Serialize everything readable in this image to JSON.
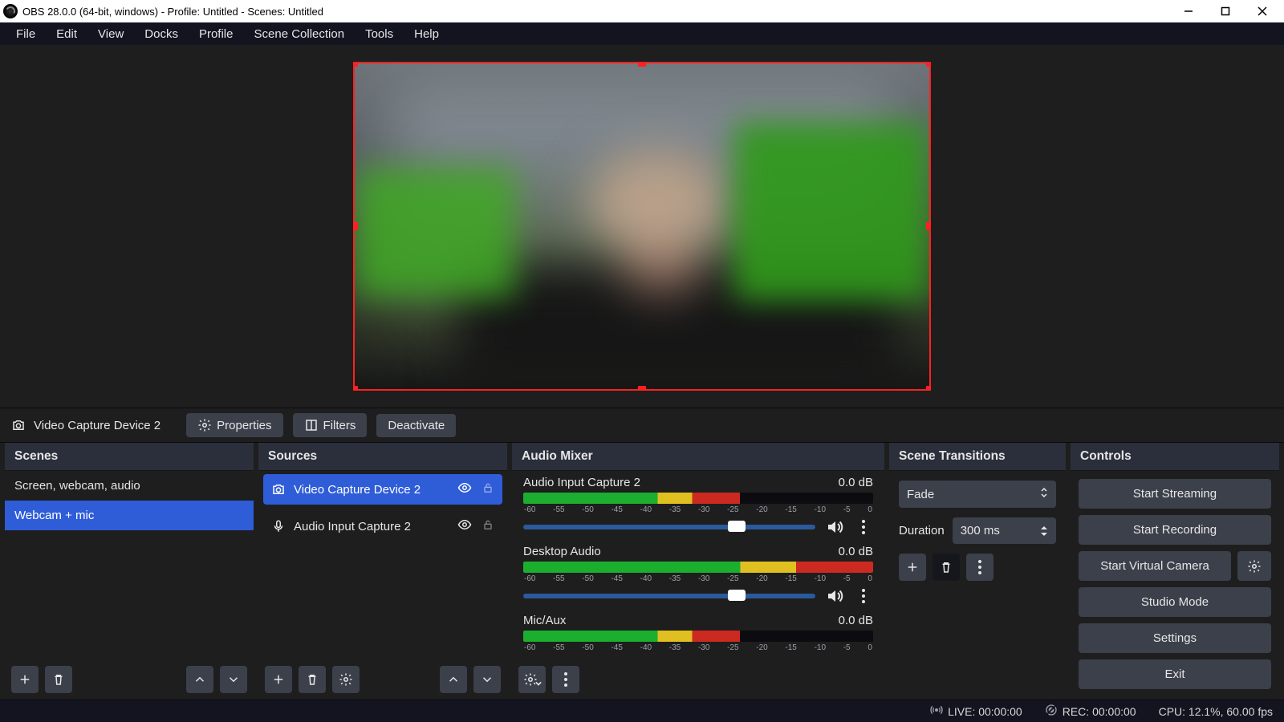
{
  "titlebar": {
    "text": "OBS 28.0.0 (64-bit, windows) - Profile: Untitled - Scenes: Untitled"
  },
  "menu": {
    "items": [
      "File",
      "Edit",
      "View",
      "Docks",
      "Profile",
      "Scene Collection",
      "Tools",
      "Help"
    ]
  },
  "contextbar": {
    "source_label": "Video Capture Device 2",
    "properties": "Properties",
    "filters": "Filters",
    "deactivate": "Deactivate"
  },
  "docks": {
    "scenes": {
      "title": "Scenes",
      "items": [
        "Screen, webcam, audio",
        "Webcam + mic"
      ],
      "selected_index": 1
    },
    "sources": {
      "title": "Sources",
      "items": [
        {
          "name": "Video Capture Device 2",
          "icon": "camera",
          "visible": true,
          "locked": false,
          "selected": true
        },
        {
          "name": "Audio Input Capture 2",
          "icon": "mic",
          "visible": true,
          "locked": false,
          "selected": false
        }
      ]
    },
    "mixer": {
      "title": "Audio Mixer",
      "ticks": [
        "-60",
        "-55",
        "-50",
        "-45",
        "-40",
        "-35",
        "-30",
        "-25",
        "-20",
        "-15",
        "-10",
        "-5",
        "0"
      ],
      "channels": [
        {
          "name": "Audio Input Capture 2",
          "db": "0.0 dB",
          "level_pct": 62,
          "slider_pct": 73
        },
        {
          "name": "Desktop Audio",
          "db": "0.0 dB",
          "level_pct": 100,
          "slider_pct": 73
        },
        {
          "name": "Mic/Aux",
          "db": "0.0 dB",
          "level_pct": 62,
          "slider_pct": 73
        }
      ]
    },
    "transitions": {
      "title": "Scene Transitions",
      "selected": "Fade",
      "duration_label": "Duration",
      "duration_value": "300 ms"
    },
    "controls": {
      "title": "Controls",
      "buttons": {
        "start_streaming": "Start Streaming",
        "start_recording": "Start Recording",
        "start_virtual_camera": "Start Virtual Camera",
        "studio_mode": "Studio Mode",
        "settings": "Settings",
        "exit": "Exit"
      }
    }
  },
  "statusbar": {
    "live": "LIVE: 00:00:00",
    "rec": "REC: 00:00:00",
    "cpu": "CPU: 12.1%, 60.00 fps"
  }
}
